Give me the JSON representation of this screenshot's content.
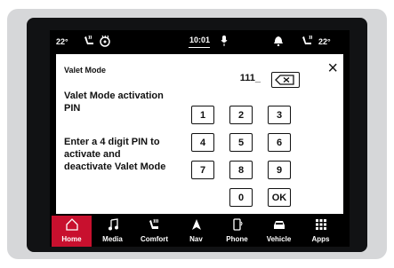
{
  "status_bar": {
    "temp_left": "22°",
    "time": "10:01",
    "temp_right": "22°",
    "icons": [
      "heated-seat-icon",
      "heated-steering-icon",
      "microphone-icon",
      "notification-bell-icon",
      "heated-seat-icon"
    ]
  },
  "dialog": {
    "title": "Valet Mode",
    "close_label": "×",
    "pin_label": "Valet Mode activation PIN",
    "instructions": "Enter a 4 digit PIN to activate and deactivate Valet Mode",
    "pin_value": "111_",
    "keys": [
      "1",
      "2",
      "3",
      "4",
      "5",
      "6",
      "7",
      "8",
      "9",
      "0",
      "OK"
    ]
  },
  "nav": {
    "items": [
      {
        "label": "Home",
        "icon": "home-icon",
        "active": true
      },
      {
        "label": "Media",
        "icon": "music-note-icon"
      },
      {
        "label": "Comfort",
        "icon": "seat-icon"
      },
      {
        "label": "Nav",
        "icon": "navigation-arrow-icon"
      },
      {
        "label": "Phone",
        "icon": "phone-icon"
      },
      {
        "label": "Vehicle",
        "icon": "car-icon"
      },
      {
        "label": "Apps",
        "icon": "apps-grid-icon"
      }
    ]
  },
  "colors": {
    "accent": "#c8102e",
    "screen_bg": "#000000",
    "panel_bg": "#ffffff"
  }
}
